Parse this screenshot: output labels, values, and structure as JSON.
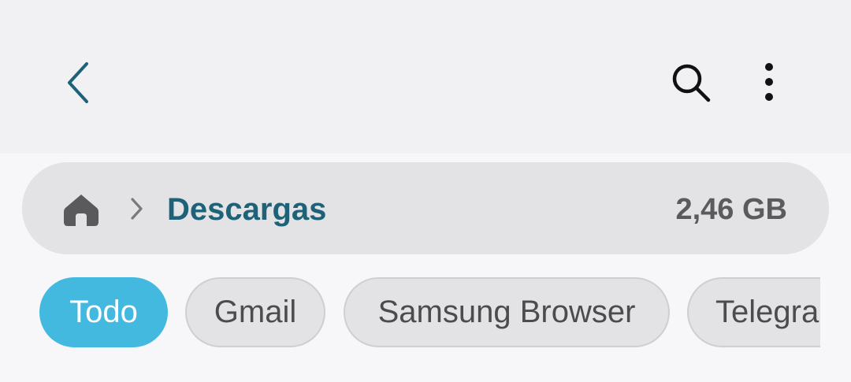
{
  "header": {
    "back_icon": "chevron-left-icon",
    "search_icon": "search-icon",
    "more_icon": "more-vertical-icon",
    "icon_color": "#1e6277"
  },
  "path": {
    "home_icon": "home-icon",
    "separator_icon": "chevron-right-icon",
    "folder_name": "Descargas",
    "storage_used": "2,46 GB"
  },
  "filters": [
    {
      "label": "Todo",
      "selected": true
    },
    {
      "label": "Gmail",
      "selected": false
    },
    {
      "label": "Samsung Browser",
      "selected": false
    },
    {
      "label": "Telegra",
      "selected": false
    }
  ],
  "colors": {
    "accent": "#44b9e0",
    "folder_text": "#1e6277",
    "topbar_bg": "#f1f1f4",
    "page_bg": "#f7f7fa",
    "pill_bg": "#e3e3e6"
  }
}
